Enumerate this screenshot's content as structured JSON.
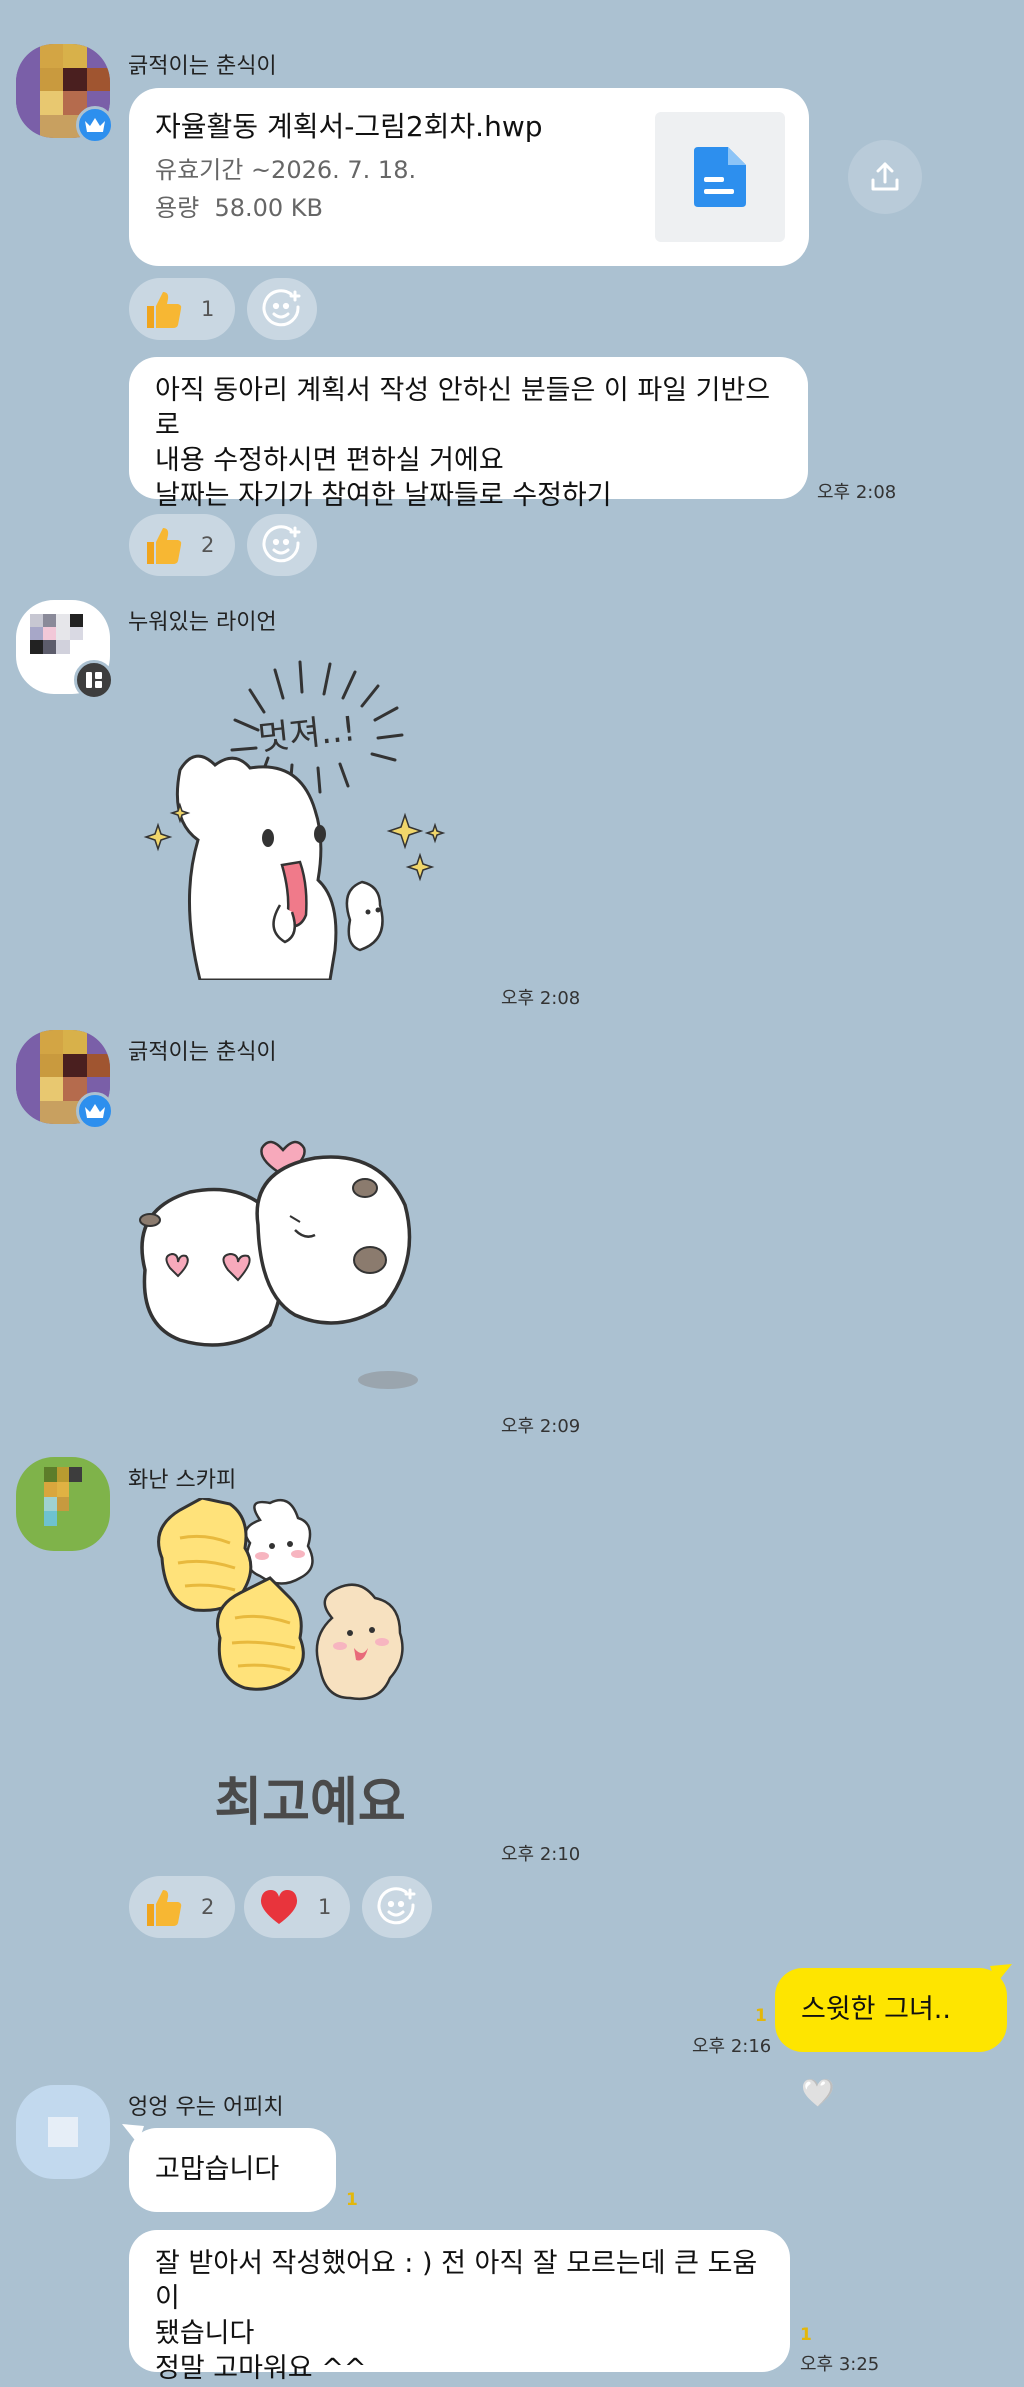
{
  "colors": {
    "background": "#abc1d1",
    "bubble_other": "#ffffff",
    "bubble_mine": "#fee500",
    "reaction_bg": "#c9d7e2",
    "file_icon": "#2d8fee",
    "unread": "#e3b70b"
  },
  "messages": {
    "m1": {
      "sender": "긁적이는 춘식이",
      "file": {
        "name": "자율활동 계획서-그림2회차.hwp",
        "expiry": "유효기간 ~2026. 7. 18.",
        "size_label": "용량",
        "size_value": "58.00 KB"
      },
      "reactions": [
        {
          "icon": "thumbs-up",
          "count": "1"
        }
      ]
    },
    "m2": {
      "lines": [
        "아직 동아리 계획서 작성 안하신 분들은 이 파일 기반으로",
        "내용 수정하시면 편하실 거에요",
        "날짜는 자기가 참여한 날짜들로 수정하기"
      ],
      "time": "오후 2:08",
      "reactions": [
        {
          "icon": "thumbs-up",
          "count": "2"
        }
      ]
    },
    "m3": {
      "sender": "누워있는 라이언",
      "sticker_text": "멋져..!",
      "time": "오후 2:08"
    },
    "m4": {
      "sender": "긁적이는 춘식이",
      "time": "오후 2:09"
    },
    "m5": {
      "sender": "화난 스카피",
      "sticker_text": "최고예요",
      "time": "오후 2:10",
      "reactions": [
        {
          "icon": "thumbs-up",
          "count": "2"
        },
        {
          "icon": "heart",
          "count": "1"
        }
      ]
    },
    "m6": {
      "text": "스윗한 그녀..🤍",
      "unread": "1",
      "time": "오후 2:16"
    },
    "m7": {
      "sender": "엉엉 우는 어피치",
      "text": "고맙습니다 ^^",
      "unread": "1"
    },
    "m8": {
      "lines": [
        "잘 받아서 작성했어요 : ) 전 아직 잘 모르는데 큰 도움이",
        "됐습니다",
        "정말 고마워요 ^^"
      ],
      "unread": "1",
      "time": "오후 3:25"
    }
  }
}
